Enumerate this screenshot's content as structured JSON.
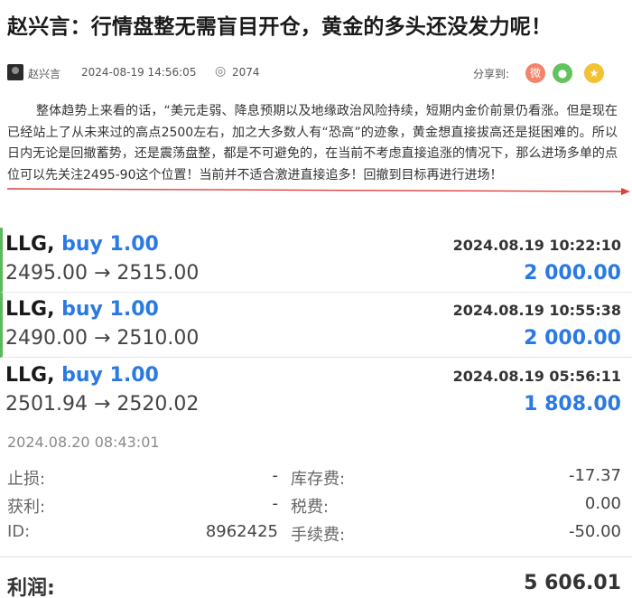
{
  "article": {
    "title": "赵兴言：行情盘整无需盲目开仓，黄金的多头还没发力呢！",
    "author": "赵兴言",
    "date": "2024-08-19 14:56:05",
    "views": "2074",
    "share_label": "分享到:",
    "share_icons": [
      "weibo-icon",
      "wechat-icon",
      "star-icon"
    ],
    "body": "整体趋势上来看的话，“美元走弱、降息预期以及地缘政治风险持续，短期内金价前景仍看涨。但是现在已经站上了从未来过的高点2500左右，加之大多数人有“恐高”的迹象，黄金想直接拔高还是挺困难的。所以日内无论是回撤蓄势，还是震荡盘整，都是不可避免的，在当前不考虑直接追涨的情况下，那么进场多单的点位可以先关注2495-90这个位置！当前并不适合激进直接追多！回撤到目标再进行进场！"
  },
  "colors": {
    "accent": "#2a7ae2",
    "active_bar": "#5cb85c",
    "annotation": "#e0403a"
  },
  "trades": [
    {
      "symbol": "LLG,",
      "side": "buy 1.00",
      "time": "2024.08.19 10:22:10",
      "prices": "2495.00 → 2515.00",
      "profit": "2 000.00"
    },
    {
      "symbol": "LLG,",
      "side": "buy 1.00",
      "time": "2024.08.19 10:55:38",
      "prices": "2490.00 → 2510.00",
      "profit": "2 000.00"
    },
    {
      "symbol": "LLG,",
      "side": "buy 1.00",
      "time": "2024.08.19 05:56:11",
      "prices": "2501.94 → 2520.02",
      "profit": "1 808.00"
    }
  ],
  "details": {
    "close_time": "2024.08.20 08:43:01",
    "stop_loss_label": "止损:",
    "stop_loss_value": "-",
    "take_profit_label": "获利:",
    "take_profit_value": "-",
    "id_label": "ID:",
    "id_value": "8962425",
    "swap_label": "库存费:",
    "swap_value": "-17.37",
    "tax_label": "税费:",
    "tax_value": "0.00",
    "commission_label": "手续费:",
    "commission_value": "-50.00"
  },
  "total": {
    "label": "利润:",
    "value": "5 606.01"
  }
}
